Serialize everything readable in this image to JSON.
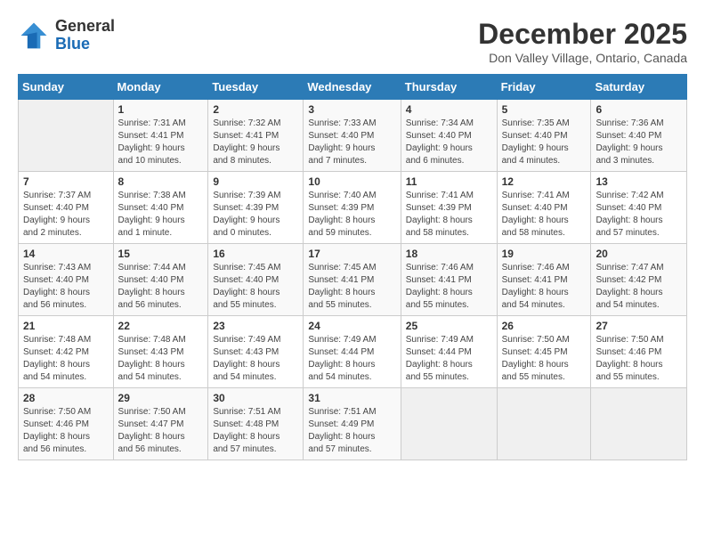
{
  "header": {
    "logo_line1": "General",
    "logo_line2": "Blue",
    "month": "December 2025",
    "location": "Don Valley Village, Ontario, Canada"
  },
  "columns": [
    "Sunday",
    "Monday",
    "Tuesday",
    "Wednesday",
    "Thursday",
    "Friday",
    "Saturday"
  ],
  "weeks": [
    [
      {
        "day": "",
        "info": ""
      },
      {
        "day": "1",
        "info": "Sunrise: 7:31 AM\nSunset: 4:41 PM\nDaylight: 9 hours\nand 10 minutes."
      },
      {
        "day": "2",
        "info": "Sunrise: 7:32 AM\nSunset: 4:41 PM\nDaylight: 9 hours\nand 8 minutes."
      },
      {
        "day": "3",
        "info": "Sunrise: 7:33 AM\nSunset: 4:40 PM\nDaylight: 9 hours\nand 7 minutes."
      },
      {
        "day": "4",
        "info": "Sunrise: 7:34 AM\nSunset: 4:40 PM\nDaylight: 9 hours\nand 6 minutes."
      },
      {
        "day": "5",
        "info": "Sunrise: 7:35 AM\nSunset: 4:40 PM\nDaylight: 9 hours\nand 4 minutes."
      },
      {
        "day": "6",
        "info": "Sunrise: 7:36 AM\nSunset: 4:40 PM\nDaylight: 9 hours\nand 3 minutes."
      }
    ],
    [
      {
        "day": "7",
        "info": "Sunrise: 7:37 AM\nSunset: 4:40 PM\nDaylight: 9 hours\nand 2 minutes."
      },
      {
        "day": "8",
        "info": "Sunrise: 7:38 AM\nSunset: 4:40 PM\nDaylight: 9 hours\nand 1 minute."
      },
      {
        "day": "9",
        "info": "Sunrise: 7:39 AM\nSunset: 4:39 PM\nDaylight: 9 hours\nand 0 minutes."
      },
      {
        "day": "10",
        "info": "Sunrise: 7:40 AM\nSunset: 4:39 PM\nDaylight: 8 hours\nand 59 minutes."
      },
      {
        "day": "11",
        "info": "Sunrise: 7:41 AM\nSunset: 4:39 PM\nDaylight: 8 hours\nand 58 minutes."
      },
      {
        "day": "12",
        "info": "Sunrise: 7:41 AM\nSunset: 4:40 PM\nDaylight: 8 hours\nand 58 minutes."
      },
      {
        "day": "13",
        "info": "Sunrise: 7:42 AM\nSunset: 4:40 PM\nDaylight: 8 hours\nand 57 minutes."
      }
    ],
    [
      {
        "day": "14",
        "info": "Sunrise: 7:43 AM\nSunset: 4:40 PM\nDaylight: 8 hours\nand 56 minutes."
      },
      {
        "day": "15",
        "info": "Sunrise: 7:44 AM\nSunset: 4:40 PM\nDaylight: 8 hours\nand 56 minutes."
      },
      {
        "day": "16",
        "info": "Sunrise: 7:45 AM\nSunset: 4:40 PM\nDaylight: 8 hours\nand 55 minutes."
      },
      {
        "day": "17",
        "info": "Sunrise: 7:45 AM\nSunset: 4:41 PM\nDaylight: 8 hours\nand 55 minutes."
      },
      {
        "day": "18",
        "info": "Sunrise: 7:46 AM\nSunset: 4:41 PM\nDaylight: 8 hours\nand 55 minutes."
      },
      {
        "day": "19",
        "info": "Sunrise: 7:46 AM\nSunset: 4:41 PM\nDaylight: 8 hours\nand 54 minutes."
      },
      {
        "day": "20",
        "info": "Sunrise: 7:47 AM\nSunset: 4:42 PM\nDaylight: 8 hours\nand 54 minutes."
      }
    ],
    [
      {
        "day": "21",
        "info": "Sunrise: 7:48 AM\nSunset: 4:42 PM\nDaylight: 8 hours\nand 54 minutes."
      },
      {
        "day": "22",
        "info": "Sunrise: 7:48 AM\nSunset: 4:43 PM\nDaylight: 8 hours\nand 54 minutes."
      },
      {
        "day": "23",
        "info": "Sunrise: 7:49 AM\nSunset: 4:43 PM\nDaylight: 8 hours\nand 54 minutes."
      },
      {
        "day": "24",
        "info": "Sunrise: 7:49 AM\nSunset: 4:44 PM\nDaylight: 8 hours\nand 54 minutes."
      },
      {
        "day": "25",
        "info": "Sunrise: 7:49 AM\nSunset: 4:44 PM\nDaylight: 8 hours\nand 55 minutes."
      },
      {
        "day": "26",
        "info": "Sunrise: 7:50 AM\nSunset: 4:45 PM\nDaylight: 8 hours\nand 55 minutes."
      },
      {
        "day": "27",
        "info": "Sunrise: 7:50 AM\nSunset: 4:46 PM\nDaylight: 8 hours\nand 55 minutes."
      }
    ],
    [
      {
        "day": "28",
        "info": "Sunrise: 7:50 AM\nSunset: 4:46 PM\nDaylight: 8 hours\nand 56 minutes."
      },
      {
        "day": "29",
        "info": "Sunrise: 7:50 AM\nSunset: 4:47 PM\nDaylight: 8 hours\nand 56 minutes."
      },
      {
        "day": "30",
        "info": "Sunrise: 7:51 AM\nSunset: 4:48 PM\nDaylight: 8 hours\nand 57 minutes."
      },
      {
        "day": "31",
        "info": "Sunrise: 7:51 AM\nSunset: 4:49 PM\nDaylight: 8 hours\nand 57 minutes."
      },
      {
        "day": "",
        "info": ""
      },
      {
        "day": "",
        "info": ""
      },
      {
        "day": "",
        "info": ""
      }
    ]
  ]
}
